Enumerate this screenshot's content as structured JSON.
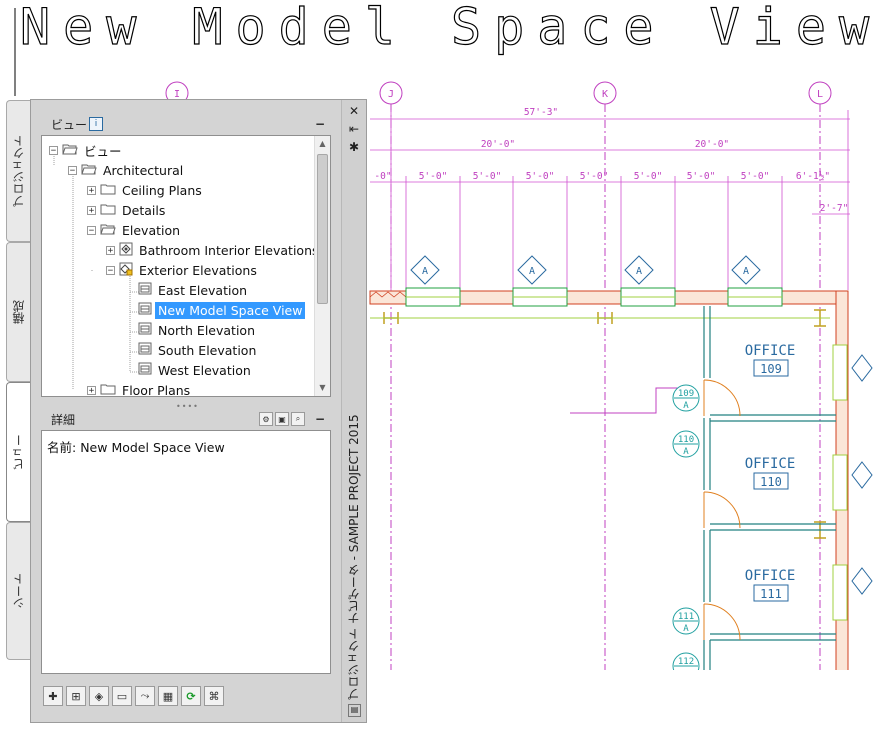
{
  "header": {
    "title": "New Model Space View"
  },
  "drawing": {
    "grid_bubbles": [
      "I",
      "J",
      "K",
      "L"
    ],
    "dimensions": {
      "overall": "57'-3\"",
      "bay_left": "20'-0\"",
      "bay_right": "20'-0\"",
      "d_left_partial": "-0\"",
      "d1": "5'-0\"",
      "d2": "5'-0\"",
      "d3": "5'-0\"",
      "d4": "5'-0\"",
      "d5": "5'-0\"",
      "d6": "5'-0\"",
      "d7": "5'-0\"",
      "d_right": "6'-1½\"",
      "d_small": "2'-7\""
    },
    "elevation_tag": "A",
    "rooms": [
      {
        "name": "OFFICE",
        "number": "109"
      },
      {
        "name": "OFFICE",
        "number": "110"
      },
      {
        "name": "OFFICE",
        "number": "111"
      }
    ],
    "door_tags": [
      {
        "number": "109",
        "letter": "A"
      },
      {
        "number": "110",
        "letter": "A"
      },
      {
        "number": "111",
        "letter": "A"
      },
      {
        "number": "112",
        "letter": ""
      }
    ]
  },
  "palette": {
    "vertical_title": "プロジェクト ナビゲータ - SAMPLE PROJECT 2015",
    "controls": {
      "close": "✕",
      "pin": "⇤",
      "settings": "✱"
    },
    "tabs": [
      {
        "label": "プロジェクト",
        "active": false
      },
      {
        "label": "構成",
        "active": false
      },
      {
        "label": "ビュー",
        "active": true
      },
      {
        "label": "シート",
        "active": false
      }
    ],
    "tree_header": {
      "label": "ビュー",
      "info": "i",
      "collapse": "−"
    },
    "tree": [
      {
        "label": "ビュー",
        "level": 0,
        "expander": "−",
        "icon": "folder-open",
        "selected": false
      },
      {
        "label": "Architectural",
        "level": 1,
        "expander": "−",
        "icon": "folder-open",
        "selected": false
      },
      {
        "label": "Ceiling Plans",
        "level": 2,
        "expander": "+",
        "icon": "folder",
        "selected": false
      },
      {
        "label": "Details",
        "level": 2,
        "expander": "+",
        "icon": "folder",
        "selected": false
      },
      {
        "label": "Elevation",
        "level": 2,
        "expander": "−",
        "icon": "folder-open",
        "selected": false
      },
      {
        "label": "Bathroom Interior Elevations",
        "level": 3,
        "expander": "+",
        "icon": "elevation-group",
        "selected": false
      },
      {
        "label": "Exterior Elevations",
        "level": 3,
        "expander": "−",
        "icon": "elevation-group-locked",
        "selected": false
      },
      {
        "label": "East Elevation",
        "level": 4,
        "expander": "",
        "icon": "view",
        "selected": false
      },
      {
        "label": "New Model Space View",
        "level": 4,
        "expander": "",
        "icon": "view",
        "selected": true
      },
      {
        "label": "North Elevation",
        "level": 4,
        "expander": "",
        "icon": "view",
        "selected": false
      },
      {
        "label": "South Elevation",
        "level": 4,
        "expander": "",
        "icon": "view",
        "selected": false
      },
      {
        "label": "West Elevation",
        "level": 4,
        "expander": "",
        "icon": "view",
        "selected": false
      },
      {
        "label": "Floor Plans",
        "level": 2,
        "expander": "+",
        "icon": "folder",
        "selected": false
      }
    ],
    "details_header": {
      "label": "詳細",
      "collapse": "−"
    },
    "details": {
      "name_label": "名前:",
      "name_value": "New Model Space View"
    },
    "toolbar": [
      "new-view-icon",
      "add-view-icon",
      "add-elevation-icon",
      "clipboard-icon",
      "regenerate-icon",
      "sheet-icon",
      "refresh-icon",
      "repath-icon"
    ]
  }
}
